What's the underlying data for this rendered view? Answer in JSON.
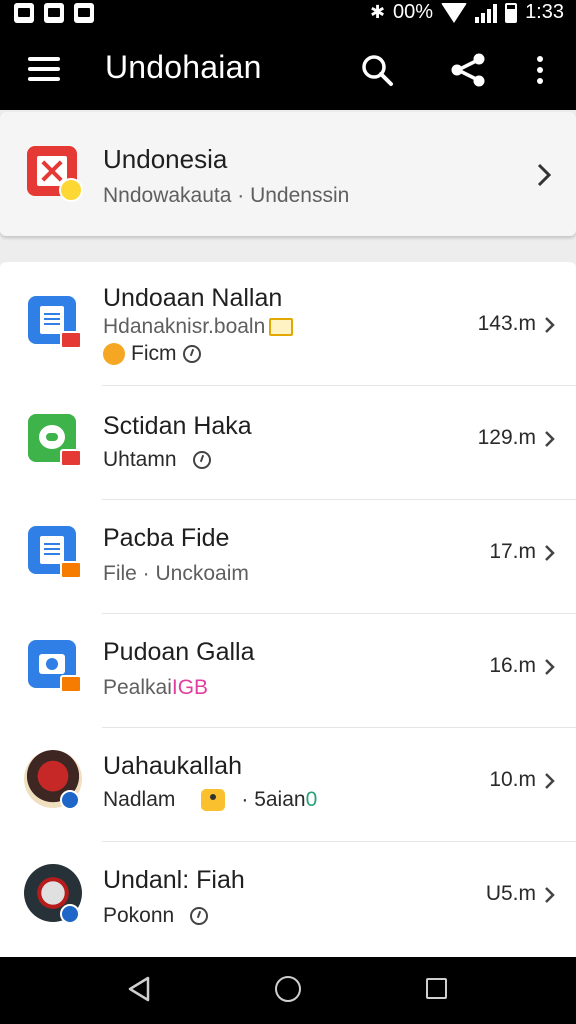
{
  "status_bar": {
    "battery_text": "00%",
    "time": "1:33"
  },
  "app_bar": {
    "title": "Undohaian"
  },
  "top_card": {
    "title": "Undonesia",
    "subtitle": "Nndowakauta · Undenssin"
  },
  "list": [
    {
      "title": "Undoaan Nallan",
      "subtitle": "Hdanaknisr.boaln",
      "extra_text": "Ficm",
      "size": "143.m"
    },
    {
      "title": "Sctidan Haka",
      "subtitle": "Uhtamn",
      "size": "129.m"
    },
    {
      "title": "Pacba Fide",
      "subtitle": "File · Unckoaim",
      "size": "17.m"
    },
    {
      "title": "Pudoan Galla",
      "subtitle": "Pealkai",
      "subtitle_accent": "IGB",
      "size": "16.m"
    },
    {
      "title": "Uahaukallah",
      "subtitle": "Nadlam",
      "subtitle_tail": "· 5aian",
      "subtitle_tail_accent": "0",
      "size": "10.m"
    },
    {
      "title": "Undanl: Fiah",
      "subtitle": "Pokonn",
      "size": "U5.m"
    }
  ],
  "colors": {
    "app_bar": "#000000",
    "background": "#ededed",
    "accent_blue": "#2f7fe6",
    "accent_green": "#3db34a",
    "accent_red": "#e53935"
  },
  "icons": [
    "menu-icon",
    "search-icon",
    "share-icon",
    "more-vert-icon",
    "chevron-right-icon",
    "back-icon",
    "home-icon",
    "recents-icon"
  ]
}
